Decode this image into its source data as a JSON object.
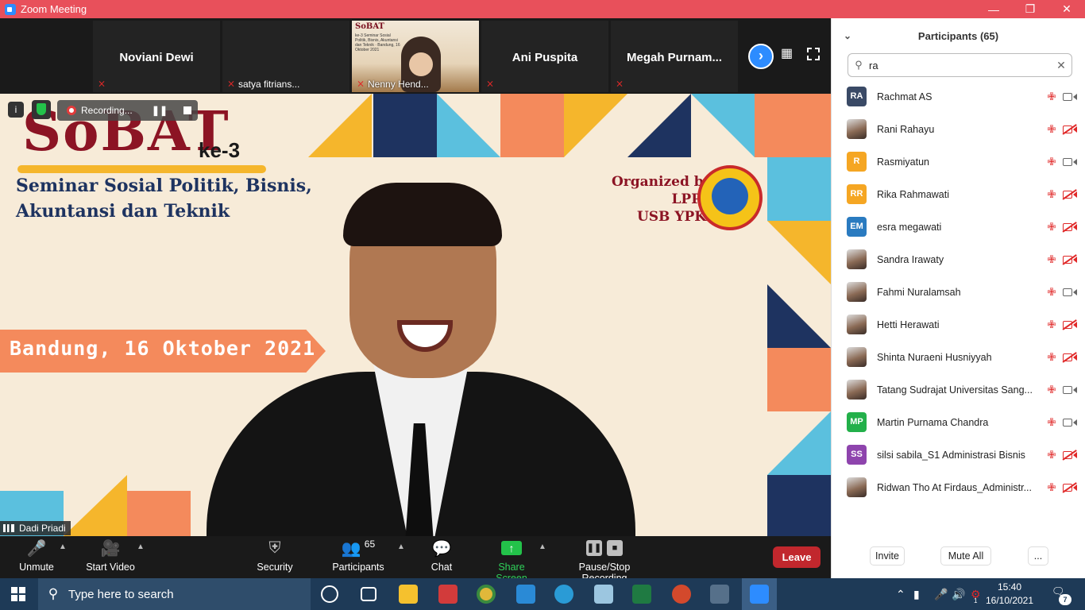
{
  "window": {
    "title": "Zoom Meeting"
  },
  "strip": {
    "tiles": [
      {
        "name": "Noviani Dewi",
        "label": ""
      },
      {
        "name": "",
        "label": "satya fitrians..."
      },
      {
        "name": "",
        "label": "Nenny Hend...",
        "slide_title": "SoBAT",
        "slide_sub": "ke-3 Seminar Sosial Politik, Bisnis, Akuntansi dan Teknik · Bandung, 16 Oktober 2021"
      },
      {
        "name": "Ani Puspita",
        "label": ""
      },
      {
        "name": "Megah  Purnam...",
        "label": ""
      }
    ]
  },
  "slide": {
    "title": "SoBAT",
    "edition": "ke-3",
    "subtitle_line1": "Seminar Sosial Politik, Bisnis,",
    "subtitle_line2": "Akuntansi dan Teknik",
    "banner": "Bandung, 16 Oktober 2021",
    "organized_line1": "Organized by:",
    "organized_line2": "LPPM",
    "organized_line3": "USB YPKP"
  },
  "recording": {
    "label": "Recording..."
  },
  "speaker": {
    "name": "Dadi Priadi"
  },
  "toolbar": {
    "unmute": "Unmute",
    "start_video": "Start Video",
    "security": "Security",
    "participants": "Participants",
    "participants_count": "65",
    "chat": "Chat",
    "share_screen": "Share Screen",
    "pause_stop": "Pause/Stop Recording",
    "leave": "Leave"
  },
  "panel": {
    "title": "Participants (65)",
    "search_value": "ra",
    "invite": "Invite",
    "mute_all": "Mute All",
    "more": "...",
    "participants": [
      {
        "initials": "RA",
        "color": "#3a4a66",
        "name": "Rachmat AS",
        "video_off": false
      },
      {
        "initials": "",
        "color": "",
        "name": "Rani Rahayu",
        "video_off": true
      },
      {
        "initials": "R",
        "color": "#f5a623",
        "name": "Rasmiyatun",
        "video_off": false
      },
      {
        "initials": "RR",
        "color": "#f5a623",
        "name": "Rika Rahmawati",
        "video_off": true
      },
      {
        "initials": "EM",
        "color": "#2a7bc0",
        "name": "esra megawati",
        "video_off": true
      },
      {
        "initials": "",
        "color": "",
        "name": "Sandra Irawaty",
        "video_off": true
      },
      {
        "initials": "",
        "color": "",
        "name": "Fahmi Nuralamsah",
        "video_off": false
      },
      {
        "initials": "",
        "color": "",
        "name": "Hetti Herawati",
        "video_off": true
      },
      {
        "initials": "",
        "color": "",
        "name": "Shinta Nuraeni Husniyyah",
        "video_off": true
      },
      {
        "initials": "",
        "color": "",
        "name": "Tatang Sudrajat Universitas Sang...",
        "video_off": false
      },
      {
        "initials": "MP",
        "color": "#23b04a",
        "name": "Martin Purnama Chandra",
        "video_off": false
      },
      {
        "initials": "SS",
        "color": "#8e44ad",
        "name": "silsi sabila_S1 Administrasi Bisnis",
        "video_off": true
      },
      {
        "initials": "",
        "color": "",
        "name": "Ridwan Tho At Firdaus_Administr...",
        "video_off": true
      }
    ]
  },
  "taskbar": {
    "search_placeholder": "Type here to search",
    "time": "15:40",
    "date": "16/10/2021",
    "notifications": "7",
    "tray_badge": "1"
  }
}
